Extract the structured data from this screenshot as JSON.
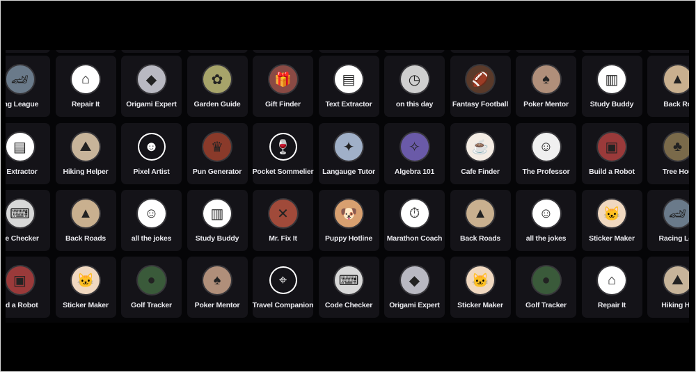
{
  "gpt_grid": {
    "rows": [
      [
        {
          "label": "ing League",
          "icon": "race-car-icon",
          "color": "#6a7a8a"
        },
        {
          "label": "Repair It",
          "icon": "house-tools-icon",
          "color": "#ffffff"
        },
        {
          "label": "Origami Expert",
          "icon": "origami-crane-icon",
          "color": "#b9b9c2"
        },
        {
          "label": "Garden Guide",
          "icon": "plant-icon",
          "color": "#a7a46a"
        },
        {
          "label": "Gift Finder",
          "icon": "gift-icon",
          "color": "#8a4a44"
        },
        {
          "label": "Text Extractor",
          "icon": "document-icon",
          "color": "#ffffff"
        },
        {
          "label": "on this day",
          "icon": "clock-book-icon",
          "color": "#cfcfcf"
        },
        {
          "label": "Fantasy Football",
          "icon": "football-icon",
          "color": "#5a3a2a"
        },
        {
          "label": "Poker Mentor",
          "icon": "cards-hand-icon",
          "color": "#b08f7a"
        },
        {
          "label": "Study Buddy",
          "icon": "book-icon",
          "color": "#ffffff"
        },
        {
          "label": "Back Ro",
          "icon": "mountain-road-icon",
          "color": "#c9b08f"
        }
      ],
      [
        {
          "label": "t Extractor",
          "icon": "document-icon",
          "color": "#ffffff"
        },
        {
          "label": "Hiking Helper",
          "icon": "hiking-boot-icon",
          "color": "#c7b49a"
        },
        {
          "label": "Pixel Artist",
          "icon": "smiley-icon",
          "color": "#141318"
        },
        {
          "label": "Pun Generator",
          "icon": "jester-icon",
          "color": "#8a3a2a"
        },
        {
          "label": "Pocket Sommelier",
          "icon": "wine-glass-icon",
          "color": "#141318"
        },
        {
          "label": "Langauge Tutor",
          "icon": "stained-glass-icon",
          "color": "#a0b0c8"
        },
        {
          "label": "Algebra 101",
          "icon": "wizard-icon",
          "color": "#6a5aa8"
        },
        {
          "label": "Cafe Finder",
          "icon": "coffee-wifi-icon",
          "color": "#f4ece4"
        },
        {
          "label": "The Professor",
          "icon": "professor-icon",
          "color": "#f0f0f0"
        },
        {
          "label": "Build a Robot",
          "icon": "robot-icon",
          "color": "#9a3a3a"
        },
        {
          "label": "Tree Hou",
          "icon": "tree-icon",
          "color": "#7a6a4a"
        }
      ],
      [
        {
          "label": "de Checker",
          "icon": "code-book-icon",
          "color": "#d8d8d8"
        },
        {
          "label": "Back Roads",
          "icon": "mountain-road-icon",
          "color": "#c9b08f"
        },
        {
          "label": "all the jokes",
          "icon": "comedian-icon",
          "color": "#ffffff"
        },
        {
          "label": "Study Buddy",
          "icon": "book-icon",
          "color": "#ffffff"
        },
        {
          "label": "Mr. Fix It",
          "icon": "wrench-icon",
          "color": "#a04a3a"
        },
        {
          "label": "Puppy Hotline",
          "icon": "puppy-icon",
          "color": "#d8a070"
        },
        {
          "label": "Marathon Coach",
          "icon": "runner-clock-icon",
          "color": "#ffffff"
        },
        {
          "label": "Back Roads",
          "icon": "mountain-road-icon",
          "color": "#c9b08f"
        },
        {
          "label": "all the jokes",
          "icon": "comedian-icon",
          "color": "#ffffff"
        },
        {
          "label": "Sticker Maker",
          "icon": "cat-icon",
          "color": "#f0d8c0"
        },
        {
          "label": "Racing Lea",
          "icon": "race-car-icon",
          "color": "#6a7a8a"
        }
      ],
      [
        {
          "label": "ild a Robot",
          "icon": "robot-icon",
          "color": "#9a3a3a"
        },
        {
          "label": "Sticker Maker",
          "icon": "cat-icon",
          "color": "#f0d8c0"
        },
        {
          "label": "Golf Tracker",
          "icon": "golf-ball-icon",
          "color": "#3a5a3a"
        },
        {
          "label": "Poker Mentor",
          "icon": "cards-hand-icon",
          "color": "#b08f7a"
        },
        {
          "label": "Travel Companion",
          "icon": "map-pin-icon",
          "color": "#141318"
        },
        {
          "label": "Code Checker",
          "icon": "code-book-icon",
          "color": "#d8d8d8"
        },
        {
          "label": "Origami Expert",
          "icon": "origami-crane-icon",
          "color": "#b9b9c2"
        },
        {
          "label": "Sticker Maker",
          "icon": "cat-icon",
          "color": "#f0d8c0"
        },
        {
          "label": "Golf Tracker",
          "icon": "golf-ball-icon",
          "color": "#3a5a3a"
        },
        {
          "label": "Repair It",
          "icon": "house-tools-icon",
          "color": "#ffffff"
        },
        {
          "label": "Hiking He",
          "icon": "hiking-boot-icon",
          "color": "#c7b49a"
        }
      ]
    ]
  }
}
